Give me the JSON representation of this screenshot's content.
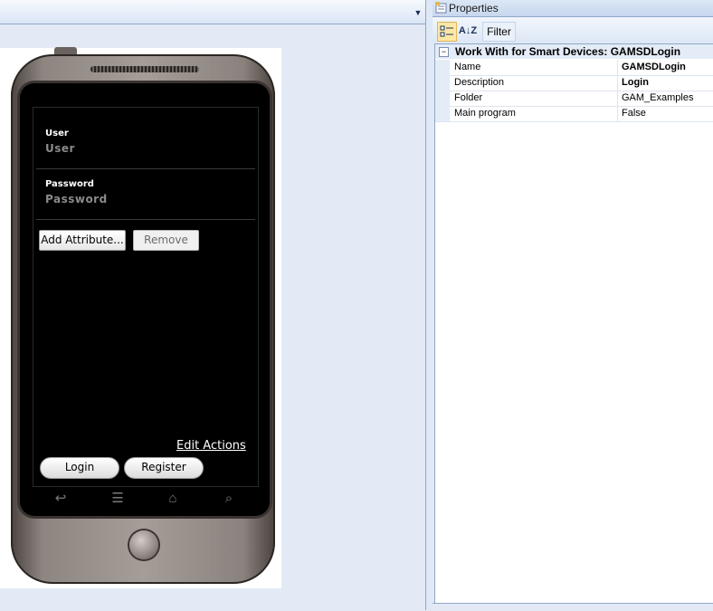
{
  "designer": {
    "dropdown_icon": "chevron-down-icon",
    "form": {
      "user_label": "User",
      "user_placeholder": "User",
      "password_label": "Password",
      "password_placeholder": "Password",
      "add_attribute_label": "Add Attribute...",
      "remove_label": "Remove",
      "edit_actions_label": "Edit Actions",
      "login_label": "Login",
      "register_label": "Register"
    },
    "nav_icons": [
      "back-icon",
      "menu-icon",
      "home-icon",
      "search-icon"
    ]
  },
  "properties": {
    "title": "Properties",
    "toolbar": {
      "alpha_sort_label": "A↓Z",
      "filter_label": "Filter"
    },
    "category": {
      "collapse_symbol": "−",
      "label": "Work With for Smart Devices: GAMSDLogin"
    },
    "rows": [
      {
        "name": "Name",
        "value": "GAMSDLogin",
        "bold": true
      },
      {
        "name": "Description",
        "value": "Login",
        "bold": true
      },
      {
        "name": "Folder",
        "value": "GAM_Examples",
        "bold": false
      },
      {
        "name": "Main program",
        "value": "False",
        "bold": false
      }
    ]
  }
}
